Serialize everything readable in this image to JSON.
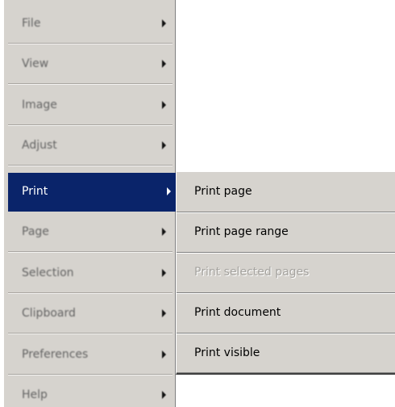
{
  "main_menu": {
    "items": [
      {
        "label": "File",
        "has_submenu": true
      },
      {
        "label": "View",
        "has_submenu": true
      },
      {
        "label": "Image",
        "has_submenu": true
      },
      {
        "label": "Adjust",
        "has_submenu": true
      },
      {
        "label": "Print",
        "has_submenu": true,
        "selected": true
      },
      {
        "label": "Page",
        "has_submenu": true
      },
      {
        "label": "Selection",
        "has_submenu": true
      },
      {
        "label": "Clipboard",
        "has_submenu": true
      },
      {
        "label": "Preferences",
        "has_submenu": true
      },
      {
        "label": "Help",
        "has_submenu": true
      }
    ]
  },
  "submenu": {
    "items": [
      {
        "label": "Print page",
        "enabled": true
      },
      {
        "label": "Print page range",
        "enabled": true
      },
      {
        "label": "Print selected pages",
        "enabled": false
      },
      {
        "label": "Print document",
        "enabled": true
      },
      {
        "label": "Print visible",
        "enabled": true
      }
    ]
  },
  "colors": {
    "menu_background": "#d6d3ce",
    "selection_background": "#0a246a",
    "selection_text": "#ffffff",
    "disabled_text": "#a5a39f"
  }
}
